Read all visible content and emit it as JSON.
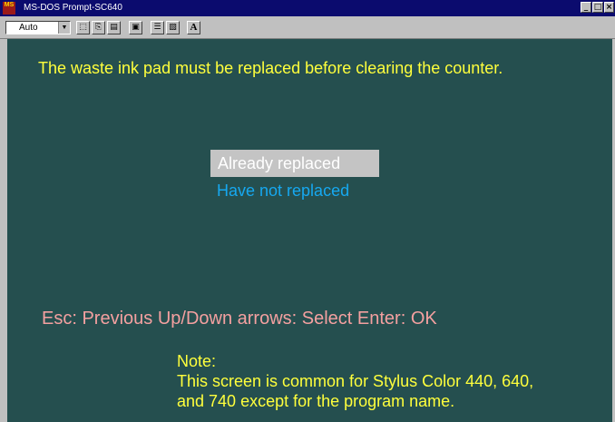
{
  "window": {
    "title": "MS-DOS Prompt-SC640",
    "icon_text": "MS"
  },
  "titlebar_buttons": {
    "minimize": "_",
    "maximize": "□",
    "close": "×"
  },
  "toolbar": {
    "font_size_value": "Auto",
    "font_size_arrow": "▼",
    "mark_icon": "⬚",
    "copy_icon": "⎘",
    "paste_icon": "▤",
    "fullscreen_icon": "▣",
    "properties_icon": "☰",
    "background_icon": "▧",
    "font_icon": "A"
  },
  "screen": {
    "header": "The waste ink pad must be replaced before clearing the counter.",
    "options": [
      "Already replaced",
      "Have not replaced"
    ],
    "selected_index": 0,
    "keyhelp": "Esc: Previous   Up/Down arrows: Select   Enter: OK",
    "note_lines": [
      "Note:",
      "This screen is common for Stylus Color 440, 640,",
      "and 740 except for the program name."
    ]
  },
  "colors": {
    "screen_bg": "#254f4f",
    "header_text": "#ffff3c",
    "selected_bg": "#c4c4c4",
    "option_text": "#16a8f0",
    "keyhelp_text": "#f4a0a0",
    "titlebar_bg": "#0b0b6e"
  }
}
